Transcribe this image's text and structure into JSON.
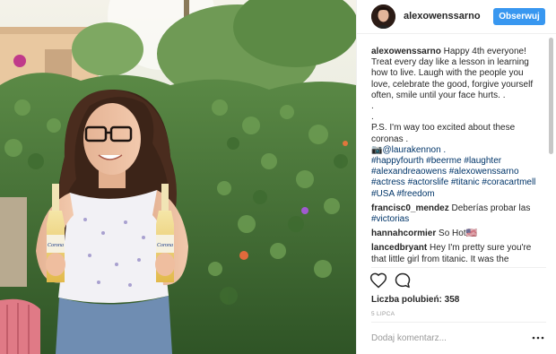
{
  "header": {
    "username": "alexowenssarno",
    "follow_label": "Obserwuj"
  },
  "caption": {
    "username": "alexowenssarno",
    "lines": [
      "Happy 4th everyone!",
      "Treat every day like a lesson in learning",
      "how to live. Laugh with the people you",
      "love, celebrate the good, forgive yourself",
      "often, smile until your face hurts. .",
      ".",
      ".",
      "P.S. I'm way too excited about these",
      "coronas ."
    ],
    "mention_line": "📷@laurakennon .",
    "hashtag_lines": [
      "#happyfourth #beerme #laughter",
      "#alexandreaowens #alexowenssarno",
      "#actress #actorslife #titanic #coracartmell",
      "#USA #freedom"
    ]
  },
  "comments": [
    {
      "username": "francisc0_mendez",
      "text": "Deberías probar las",
      "extra_line": "#victorias"
    },
    {
      "username": "hannahcormier",
      "text": "So Hot🇺🇸",
      "extra_line": ""
    },
    {
      "username": "lancedbryant",
      "text": "Hey I'm pretty sure you're",
      "extra_line": "that little girl from titanic. It was the"
    }
  ],
  "likes": "Liczba polubień: 358",
  "date": "5 LIPCA",
  "add_comment_placeholder": "Dodaj komentarz...",
  "photo": {
    "bottle_label_left": "Corona",
    "bottle_label_right": "Corona"
  },
  "colors": {
    "follow_button": "#3897f0",
    "hashtag": "#003569",
    "muted": "#999999"
  },
  "icons": [
    "heart-icon",
    "comment-icon",
    "more-icon"
  ]
}
